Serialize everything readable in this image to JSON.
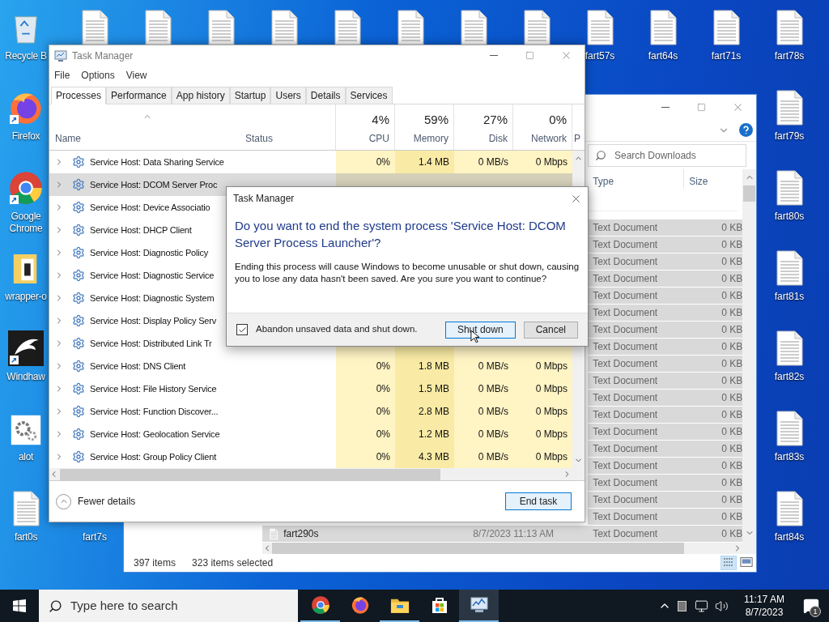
{
  "desktop_icons": [
    {
      "kind": "recycle",
      "label": "Recycle B"
    },
    {
      "kind": "file"
    },
    {
      "kind": "file"
    },
    {
      "kind": "file"
    },
    {
      "kind": "file"
    },
    {
      "kind": "file"
    },
    {
      "kind": "file"
    },
    {
      "kind": "file"
    },
    {
      "kind": "file"
    },
    {
      "kind": "file",
      "label": "fart57s"
    },
    {
      "kind": "file",
      "label": "fart64s"
    },
    {
      "kind": "file",
      "label": "fart71s"
    },
    {
      "kind": "file",
      "label": "fart78s"
    },
    {
      "kind": "firefox",
      "label": "Firefox",
      "shortcut": true
    },
    {
      "kind": "file",
      "label": "fart79s"
    },
    {
      "kind": "chrome",
      "label": "Google Chrome",
      "shortcut": true
    },
    {
      "kind": "file",
      "label": "fart80s"
    },
    {
      "kind": "folder",
      "label": "wrapper-o"
    },
    {
      "kind": "file",
      "label": "fart81s"
    },
    {
      "kind": "eagle",
      "label": "Windhaw",
      "shortcut": true
    },
    {
      "kind": "file",
      "label": "fart82s"
    },
    {
      "kind": "gear",
      "label": "alot"
    },
    {
      "kind": "file",
      "label": "fart83s"
    },
    {
      "kind": "file",
      "label": "fart0s"
    },
    {
      "kind": "label",
      "label": "fart7s"
    },
    {
      "kind": "file",
      "label": "fart84s"
    }
  ],
  "explorer": {
    "search_placeholder": "Search Downloads",
    "columns": [
      {
        "label": "Type"
      },
      {
        "label": "Size"
      }
    ],
    "rows": [
      {
        "type": "Text Document",
        "size": "0 KB",
        "selected": true
      },
      {
        "type": "Text Document",
        "size": "0 KB",
        "selected": true
      },
      {
        "type": "Text Document",
        "size": "0 KB",
        "selected": true
      },
      {
        "type": "Text Document",
        "size": "0 KB",
        "selected": true
      },
      {
        "type": "Text Document",
        "size": "0 KB",
        "selected": true
      },
      {
        "type": "Text Document",
        "size": "0 KB",
        "selected": true
      },
      {
        "type": "Text Document",
        "size": "0 KB",
        "selected": true
      },
      {
        "type": "Text Document",
        "size": "0 KB",
        "selected": true
      },
      {
        "type": "Text Document",
        "size": "0 KB",
        "selected": true
      },
      {
        "type": "Text Document",
        "size": "0 KB",
        "selected": true
      },
      {
        "type": "Text Document",
        "size": "0 KB",
        "selected": true
      },
      {
        "type": "Text Document",
        "size": "0 KB",
        "selected": true
      },
      {
        "type": "Text Document",
        "size": "0 KB",
        "selected": true
      },
      {
        "type": "Text Document",
        "size": "0 KB",
        "selected": true
      },
      {
        "type": "Text Document",
        "size": "0 KB",
        "selected": true
      },
      {
        "type": "Text Document",
        "size": "0 KB",
        "selected": true
      },
      {
        "type": "Text Document",
        "size": "0 KB",
        "selected": true
      },
      {
        "type": "Text Document",
        "size": "0 KB",
        "selected": true
      },
      {
        "name": "fart290s",
        "date": "8/7/2023 11:13 AM",
        "type": "Text Document",
        "size": "0 KB",
        "selected": true
      }
    ],
    "item_count": "397 items",
    "selected_count": "323 items selected"
  },
  "task_manager": {
    "title": "Task Manager",
    "menu": [
      "File",
      "Options",
      "View"
    ],
    "tabs": [
      {
        "label": "Processes",
        "selected": true
      },
      {
        "label": "Performance",
        "selected": false
      },
      {
        "label": "App history",
        "selected": false
      },
      {
        "label": "Startup",
        "selected": false
      },
      {
        "label": "Users",
        "selected": false
      },
      {
        "label": "Details",
        "selected": false
      },
      {
        "label": "Services",
        "selected": false
      }
    ],
    "columns": [
      {
        "label": "Name"
      },
      {
        "label": "Status"
      },
      {
        "label": "CPU",
        "percent": "4%"
      },
      {
        "label": "Memory",
        "percent": "59%"
      },
      {
        "label": "Disk",
        "percent": "27%"
      },
      {
        "label": "Network",
        "percent": "0%"
      },
      {
        "label": "P"
      }
    ],
    "rows": [
      {
        "name": "Service Host: Data Sharing Service",
        "selected": false,
        "cpu": "0%",
        "memory": "1.4 MB",
        "disk": "0 MB/s",
        "network": "0 Mbps"
      },
      {
        "name": "Service Host: DCOM Server Proc",
        "selected": true
      },
      {
        "name": "Service Host: Device Associatio",
        "selected": false
      },
      {
        "name": "Service Host: DHCP Client",
        "selected": false
      },
      {
        "name": "Service Host: Diagnostic Policy",
        "selected": false
      },
      {
        "name": "Service Host: Diagnostic Service",
        "selected": false
      },
      {
        "name": "Service Host: Diagnostic System",
        "selected": false
      },
      {
        "name": "Service Host: Display Policy Serv",
        "selected": false
      },
      {
        "name": "Service Host: Distributed Link Tr",
        "selected": false
      },
      {
        "name": "Service Host: DNS Client",
        "selected": false,
        "cpu": "0%",
        "memory": "1.8 MB",
        "disk": "0 MB/s",
        "network": "0 Mbps"
      },
      {
        "name": "Service Host: File History Service",
        "selected": false,
        "cpu": "0%",
        "memory": "1.5 MB",
        "disk": "0 MB/s",
        "network": "0 Mbps"
      },
      {
        "name": "Service Host: Function Discover...",
        "selected": false,
        "cpu": "0%",
        "memory": "2.8 MB",
        "disk": "0 MB/s",
        "network": "0 Mbps"
      },
      {
        "name": "Service Host: Geolocation Service",
        "selected": false,
        "cpu": "0%",
        "memory": "1.2 MB",
        "disk": "0 MB/s",
        "network": "0 Mbps"
      },
      {
        "name": "Service Host: Group Policy Client",
        "selected": false,
        "cpu": "0%",
        "memory": "4.3 MB",
        "disk": "0 MB/s",
        "network": "0 Mbps"
      }
    ],
    "fewer_details": "Fewer details",
    "end_task": "End task"
  },
  "dialog": {
    "title": "Task Manager",
    "heading": "Do you want to end the system process 'Service Host: DCOM Server Process Launcher'?",
    "message": "Ending this process will cause Windows to become unusable or shut down, causing you to lose any data hasn't been saved. Are you sure you want to continue?",
    "checkbox": {
      "label": "Abandon unsaved data and shut down.",
      "checked": true
    },
    "buttons": [
      {
        "label": "Shut down",
        "focused": true
      },
      {
        "label": "Cancel",
        "focused": false
      }
    ]
  },
  "taskbar": {
    "search_placeholder": "Type here to search",
    "apps": [
      {
        "kind": "chrome",
        "running": true,
        "active": false
      },
      {
        "kind": "firefox",
        "running": false,
        "active": false
      },
      {
        "kind": "folder",
        "running": true,
        "active": false
      },
      {
        "kind": "store",
        "running": false,
        "active": false
      },
      {
        "kind": "taskmgr",
        "running": true,
        "active": true
      }
    ],
    "time": "11:17 AM",
    "date": "8/7/2023",
    "notification_count": "1"
  }
}
